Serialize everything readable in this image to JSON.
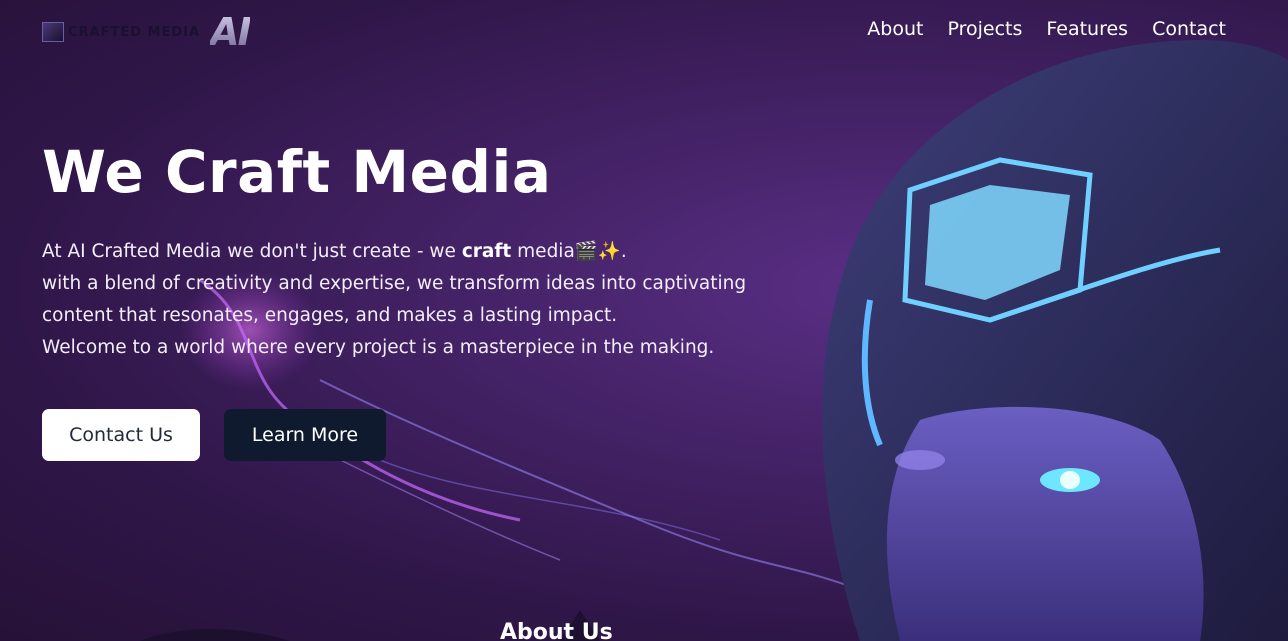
{
  "brand": {
    "logo_text": "CRAFTED MEDIA",
    "logo_mark": "AI"
  },
  "nav": {
    "items": [
      {
        "label": "About"
      },
      {
        "label": "Projects"
      },
      {
        "label": "Features"
      },
      {
        "label": "Contact"
      }
    ]
  },
  "hero": {
    "title": "We Craft Media",
    "line1_prefix": "At AI Crafted Media we don't just create - we ",
    "line1_bold": "craft",
    "line1_suffix": " media",
    "line1_emoji": "🎬✨.",
    "line2": "with a blend of creativity and expertise, we transform ideas into captivating",
    "line3": "content that resonates, engages, and makes a lasting impact.",
    "line4": "Welcome to a world where every project is a masterpiece in the making.",
    "contact_button": "Contact Us",
    "learn_button": "Learn More"
  },
  "about": {
    "heading": "About Us"
  },
  "colors": {
    "background": "#3a1c58",
    "contact_button_bg": "#ffffff",
    "learn_button_bg": "#0f1a2e",
    "helmet_glow": "#7fd8ff"
  }
}
